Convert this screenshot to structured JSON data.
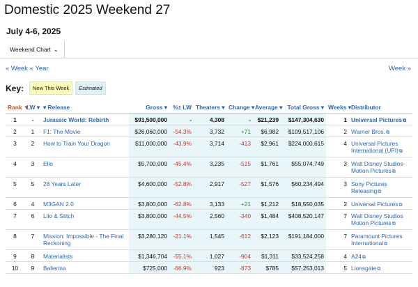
{
  "title": "Domestic 2025 Weekend 27",
  "subtitle": "July 4-6, 2025",
  "view_tab": {
    "label": "Weekend Chart",
    "chevron": "chevron-down-icon"
  },
  "nav": {
    "prev_week": "« Week",
    "prev_year": "« Year",
    "next_week": "Week »"
  },
  "key": {
    "label": "Key:",
    "new": "New This Week",
    "estimated": "Estimated"
  },
  "colors": {
    "link": "#2a66b6",
    "negative": "#c0392b",
    "positive": "#2e8b2e",
    "new_bg": "#fcfcb8",
    "estimated_bg": "#ddf2f6",
    "gross_bg": "#e8f6fa"
  },
  "table": {
    "headers": {
      "rank": "Rank",
      "lw": "LW",
      "release": "Release",
      "gross": "Gross",
      "pct_lw": "%± LW",
      "theaters": "Theaters",
      "change": "Change",
      "average": "Average",
      "total_gross": "Total Gross",
      "weeks": "Weeks",
      "distributor": "Distributor"
    },
    "rows": [
      {
        "rank": "1",
        "lw": "-",
        "release": "Jurassic World: Rebirth",
        "gross": "$91,500,000",
        "pct": "-",
        "theaters": "4,308",
        "change": "-",
        "average": "$21,239",
        "total": "$147,304,630",
        "weeks": "1",
        "dist1": "Universal Pictures",
        "dist2": ""
      },
      {
        "rank": "2",
        "lw": "1",
        "release": "F1: The Movie",
        "gross": "$26,060,000",
        "pct": "-54.3%",
        "theaters": "3,732",
        "change": "+71",
        "average": "$6,982",
        "total": "$109,517,106",
        "weeks": "2",
        "dist1": "Warner Bros.",
        "dist2": ""
      },
      {
        "rank": "3",
        "lw": "2",
        "release": "How to Train Your Dragon",
        "gross": "$11,000,000",
        "pct": "-43.9%",
        "theaters": "3,714",
        "change": "-413",
        "average": "$2,961",
        "total": "$224,000,615",
        "weeks": "4",
        "dist1": "Universal Pictures",
        "dist2": "International (UPI)"
      },
      {
        "rank": "4",
        "lw": "3",
        "release": "Elio",
        "gross": "$5,700,000",
        "pct": "-45.4%",
        "theaters": "3,235",
        "change": "-515",
        "average": "$1,761",
        "total": "$55,074,749",
        "weeks": "3",
        "dist1": "Walt Disney Studios",
        "dist2": "Motion Pictures"
      },
      {
        "rank": "5",
        "lw": "5",
        "release": "28 Years Later",
        "gross": "$4,600,000",
        "pct": "-52.8%",
        "theaters": "2,917",
        "change": "-527",
        "average": "$1,576",
        "total": "$60,234,494",
        "weeks": "3",
        "dist1": "Sony Pictures Releasing",
        "dist2": ""
      },
      {
        "rank": "6",
        "lw": "4",
        "release": "M3GAN 2.0",
        "gross": "$3,800,000",
        "pct": "-62.8%",
        "theaters": "3,133",
        "change": "+21",
        "average": "$1,212",
        "total": "$18,550,035",
        "weeks": "2",
        "dist1": "Universal Pictures",
        "dist2": ""
      },
      {
        "rank": "7",
        "lw": "6",
        "release": "Lilo & Stitch",
        "gross": "$3,800,000",
        "pct": "-44.5%",
        "theaters": "2,560",
        "change": "-340",
        "average": "$1,484",
        "total": "$408,520,147",
        "weeks": "7",
        "dist1": "Walt Disney Studios",
        "dist2": "Motion Pictures"
      },
      {
        "rank": "8",
        "lw": "7",
        "release": "Mission: Impossible - The Final Reckoning",
        "gross": "$3,280,120",
        "pct": "-21.1%",
        "theaters": "1,545",
        "change": "-612",
        "average": "$2,123",
        "total": "$191,184,000",
        "weeks": "7",
        "dist1": "Paramount Pictures",
        "dist2": "International"
      },
      {
        "rank": "9",
        "lw": "8",
        "release": "Materialists",
        "gross": "$1,346,704",
        "pct": "-55.1%",
        "theaters": "1,027",
        "change": "-904",
        "average": "$1,311",
        "total": "$33,524,258",
        "weeks": "4",
        "dist1": "A24",
        "dist2": ""
      },
      {
        "rank": "10",
        "lw": "9",
        "release": "Ballerina",
        "gross": "$725,000",
        "pct": "-66.9%",
        "theaters": "923",
        "change": "-873",
        "average": "$785",
        "total": "$57,253,013",
        "weeks": "5",
        "dist1": "Lionsgate",
        "dist2": ""
      }
    ]
  }
}
